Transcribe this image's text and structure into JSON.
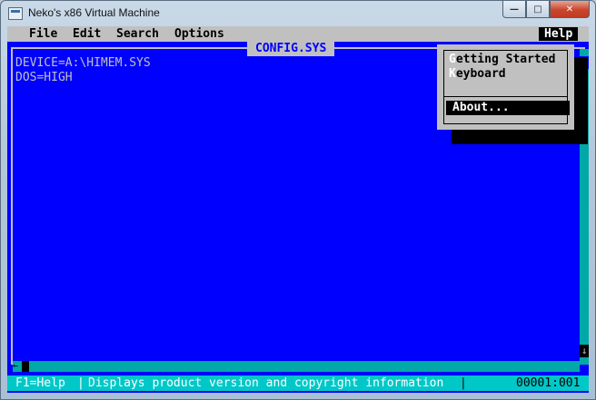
{
  "window": {
    "title": "Neko's x86 Virtual Machine",
    "controls": {
      "minimize": "—",
      "maximize": "□",
      "close": "✕"
    }
  },
  "menubar": {
    "items": [
      "File",
      "Edit",
      "Search",
      "Options"
    ],
    "help": "Help"
  },
  "document": {
    "title": "CONFIG.SYS",
    "lines": [
      "DEVICE=A:\\HIMEM.SYS",
      "DOS=HIGH"
    ]
  },
  "help_menu": {
    "items": [
      {
        "hotkey": "G",
        "rest": "etting Started"
      },
      {
        "hotkey": "K",
        "rest": "eyboard"
      }
    ],
    "selected": "About..."
  },
  "scrollbar": {
    "up_arrow": "↑",
    "down_arrow": "↓",
    "left_arrow": "←"
  },
  "statusbar": {
    "help_key": "F1=Help",
    "separator": "|",
    "message": "Displays product version and copyright information",
    "separator2": "|",
    "position": "00001:001"
  },
  "colors": {
    "dos_blue": "#0000fe",
    "dos_gray": "#c0c0c0",
    "status_cyan": "#00c8c8"
  }
}
